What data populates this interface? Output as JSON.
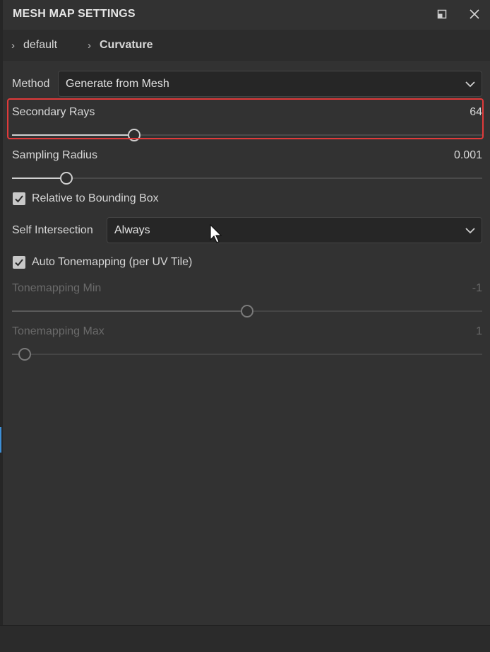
{
  "window": {
    "title": "MESH MAP SETTINGS",
    "icons": {
      "float": "float-window-icon",
      "close": "close-icon"
    }
  },
  "breadcrumb": [
    {
      "label": "default"
    },
    {
      "label": "Curvature"
    }
  ],
  "method": {
    "label": "Method",
    "value": "Generate from Mesh"
  },
  "secondary_rays": {
    "label": "Secondary Rays",
    "value": "64",
    "fraction": 0.26
  },
  "sampling_radius": {
    "label": "Sampling Radius",
    "value": "0.001",
    "fraction": 0.115
  },
  "relative_bbox": {
    "label": "Relative to Bounding Box",
    "checked": true
  },
  "self_intersection": {
    "label": "Self Intersection",
    "value": "Always"
  },
  "auto_tonemapping": {
    "label": "Auto Tonemapping (per UV Tile)",
    "checked": true
  },
  "tonemapping_min": {
    "label": "Tonemapping Min",
    "value": "-1",
    "fraction": 0.5,
    "enabled": false
  },
  "tonemapping_max": {
    "label": "Tonemapping Max",
    "value": "1",
    "fraction": 0.027,
    "enabled": false
  },
  "colors": {
    "highlight": "#e03a3a",
    "panel_bg": "#323232",
    "field_bg": "#262626",
    "accent": "#3d8fd6"
  }
}
